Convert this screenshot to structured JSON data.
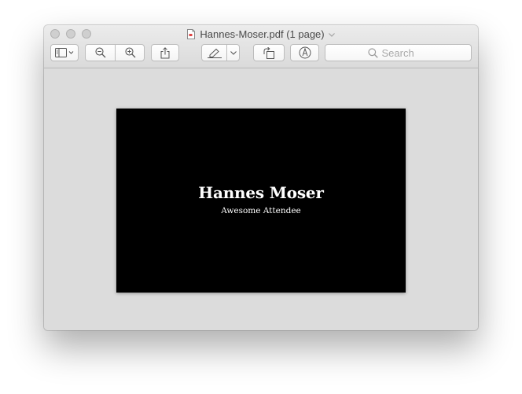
{
  "window": {
    "title": "Hannes-Moser.pdf (1 page)",
    "traffic_lights": [
      "close",
      "minimize",
      "zoom"
    ],
    "state": "inactive"
  },
  "toolbar": {
    "sidebar_icon": "sidebar-icon",
    "zoom_out_icon": "zoom-out-icon",
    "zoom_in_icon": "zoom-in-icon",
    "share_icon": "share-icon",
    "markup_icon": "highlighter-icon",
    "rotate_icon": "rotate-icon",
    "annotate_icon": "pen-circle-icon",
    "search": {
      "placeholder": "Search",
      "value": ""
    }
  },
  "document": {
    "name": "Hannes Moser",
    "role": "Awesome Attendee",
    "page_background": "#000000",
    "text_color": "#ffffff"
  },
  "colors": {
    "content_background": "#dcdcdc",
    "toolbar_background": "#e3e3e3"
  }
}
